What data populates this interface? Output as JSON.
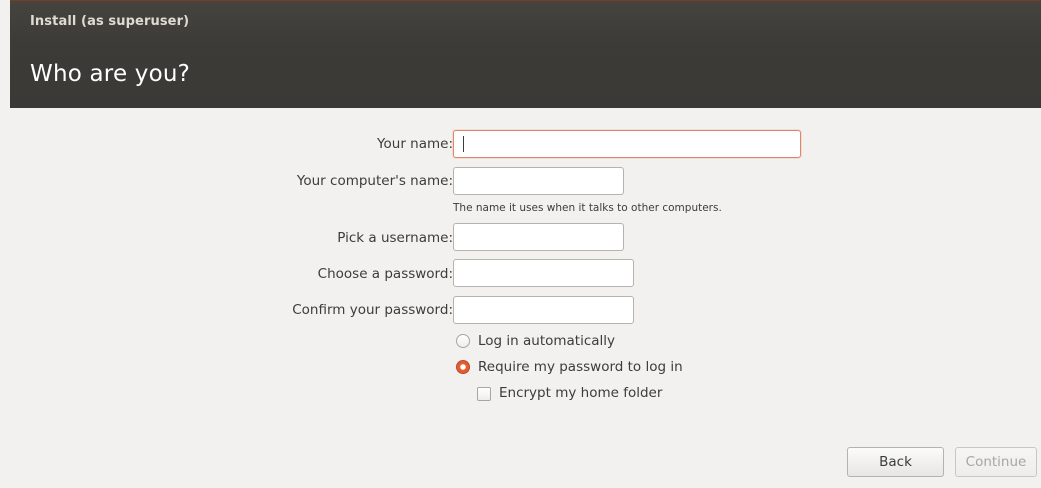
{
  "window": {
    "title": "Install (as superuser)",
    "heading": "Who are you?"
  },
  "form": {
    "name_label": "Your name:",
    "name_value": "",
    "computer_label": "Your computer's name:",
    "computer_value": "",
    "computer_hint": "The name it uses when it talks to other computers.",
    "username_label": "Pick a username:",
    "username_value": "",
    "password_label": "Choose a password:",
    "password_value": "",
    "confirm_label": "Confirm your password:",
    "confirm_value": ""
  },
  "login_options": {
    "auto_label": "Log in automatically",
    "auto_selected": false,
    "require_label": "Require my password to log in",
    "require_selected": true,
    "encrypt_label": "Encrypt my home folder",
    "encrypt_checked": false
  },
  "buttons": {
    "back_label": "Back",
    "continue_label": "Continue",
    "continue_enabled": false
  },
  "colors": {
    "titlebar_bg": "#3c3b37",
    "accent": "#e35d2f",
    "content_bg": "#f2f1f0"
  }
}
